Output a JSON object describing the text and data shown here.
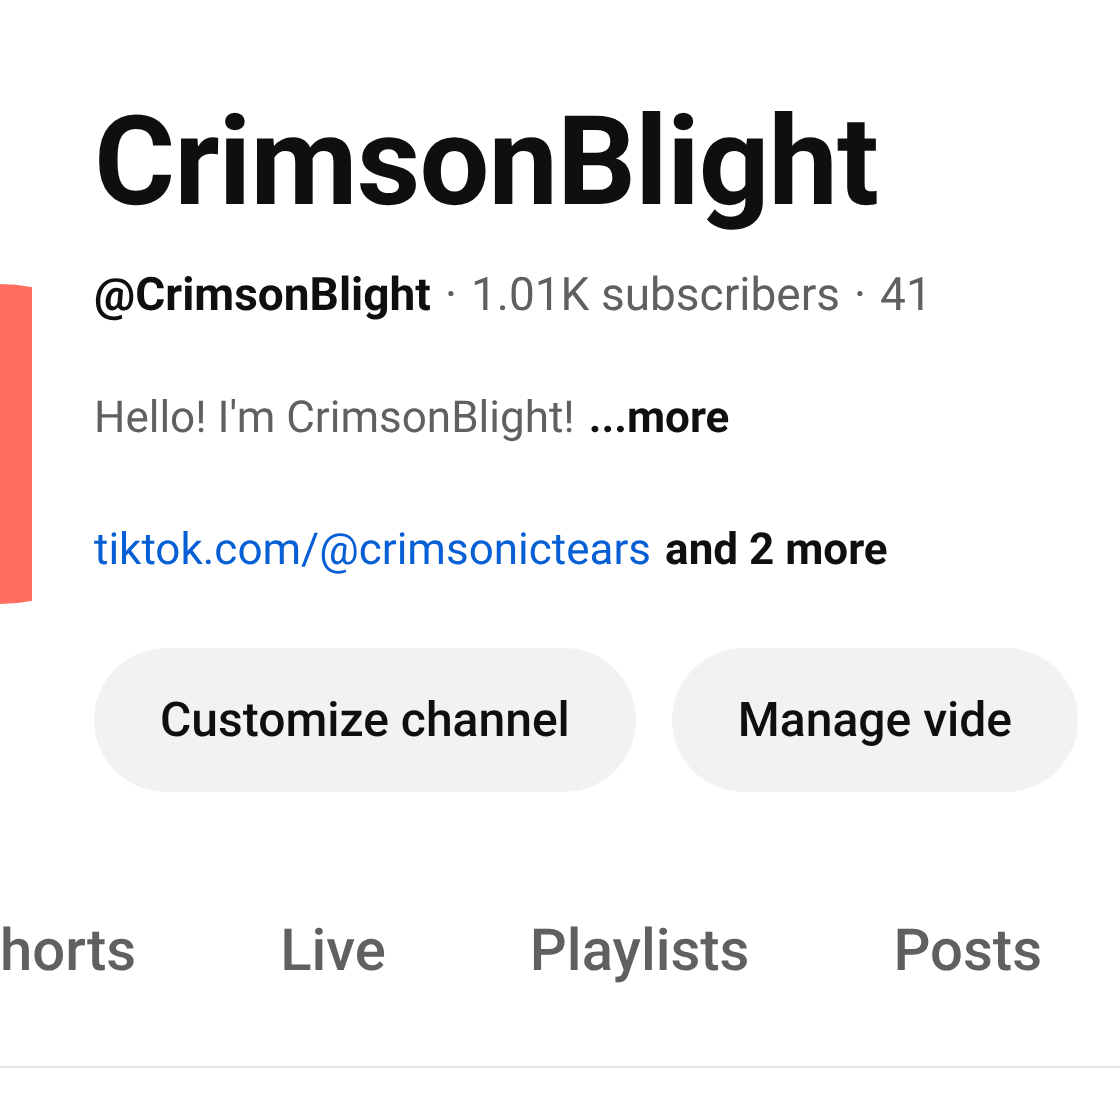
{
  "channel": {
    "name": "CrimsonBlight",
    "handle": "@CrimsonBlight",
    "separator": "·",
    "stats": [
      "1.01K subscribers",
      "41"
    ],
    "description": "Hello! I'm CrimsonBlight!",
    "more_link": "...more",
    "link": "tiktok.com/@crimsonictears",
    "more_links": "and 2 more"
  },
  "buttons": [
    "Customize channel",
    "Manage vide"
  ],
  "tabs": [
    "horts",
    "Live",
    "Playlists",
    "Posts"
  ]
}
